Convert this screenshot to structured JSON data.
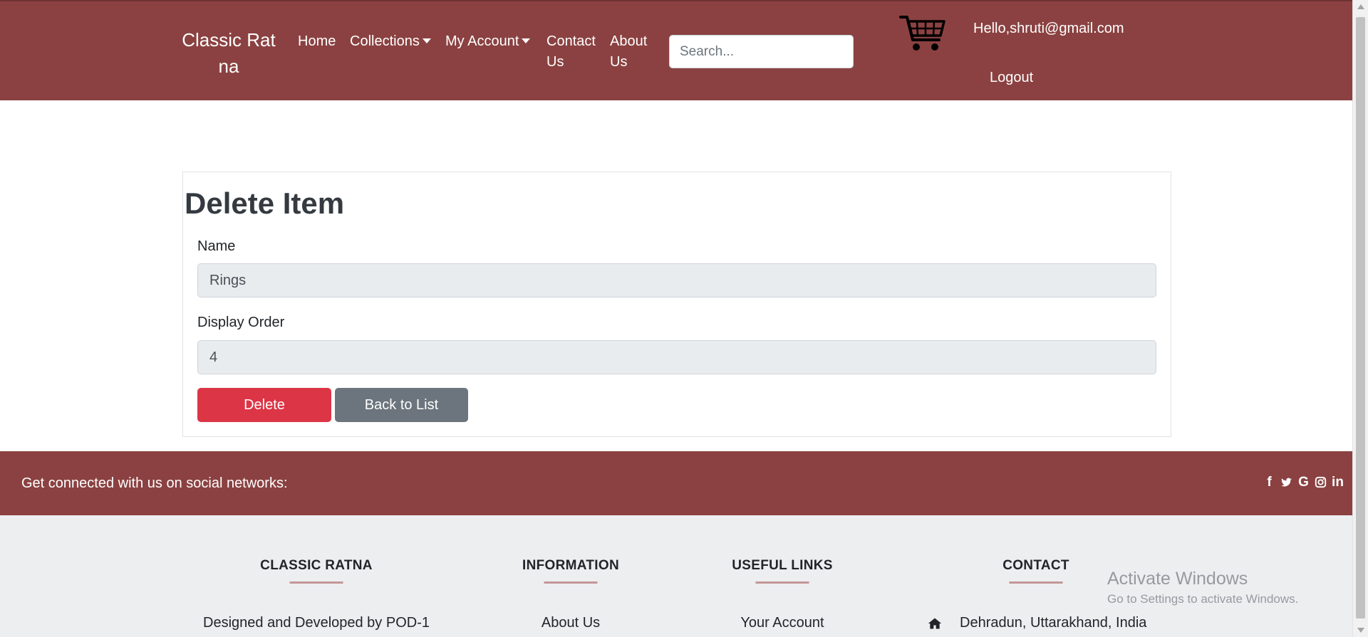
{
  "navbar": {
    "brand": "Classic Ratna",
    "links": {
      "home": "Home",
      "collections": "Collections",
      "my_account": "My Account",
      "contact_us": "Contact Us",
      "about_us": "About Us"
    },
    "search_placeholder": "Search...",
    "greeting": "Hello,shruti@gmail.com",
    "logout": "Logout",
    "cart_icon": "shopping-cart-icon"
  },
  "form": {
    "title": "Delete Item",
    "name_label": "Name",
    "name_value": "Rings",
    "order_label": "Display Order",
    "order_value": "4",
    "delete_label": "Delete",
    "back_label": "Back to List"
  },
  "social": {
    "text": "Get connected with us on social networks:",
    "icons": [
      "facebook-icon",
      "twitter-icon",
      "google-icon",
      "instagram-icon",
      "linkedin-icon"
    ]
  },
  "footer": {
    "columns": [
      {
        "title": "CLASSIC RATNA",
        "text": "Designed and Developed by POD-1"
      },
      {
        "title": "INFORMATION",
        "text": "About Us"
      },
      {
        "title": "USEFUL LINKS",
        "text": "Your Account"
      },
      {
        "title": "CONTACT",
        "text": "Dehradun, Uttarakhand, India"
      }
    ]
  },
  "watermark": {
    "line1": "Activate Windows",
    "line2": "Go to Settings to activate Windows."
  },
  "colors": {
    "brand_maroon": "#8b4141",
    "danger": "#dc3545",
    "secondary": "#6c757d",
    "footer_bg": "#eceef0"
  }
}
